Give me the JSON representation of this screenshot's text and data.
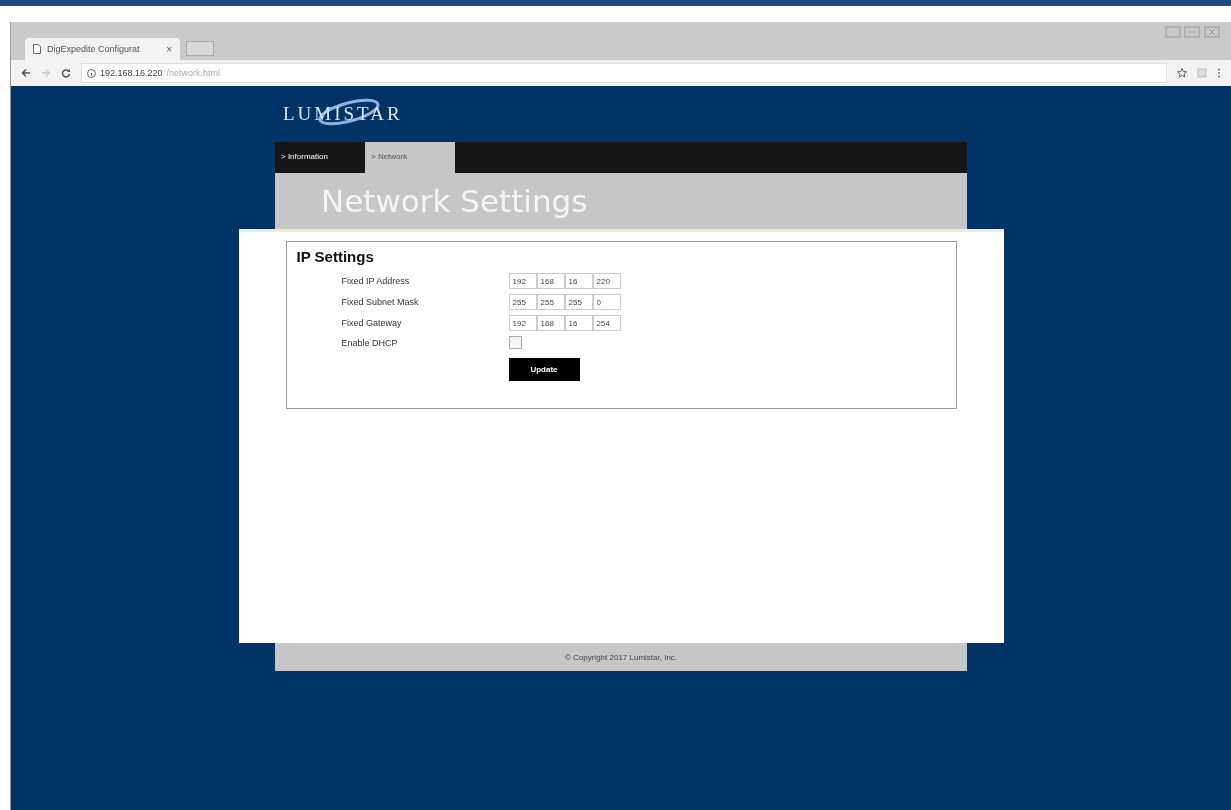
{
  "browser": {
    "tab_title": "DigExpedite Configurat",
    "tab_close": "×",
    "address_host": "192.168.16.220",
    "address_path": "/network.html"
  },
  "logo": {
    "text": "LUMISTAR"
  },
  "nav": [
    {
      "label": "> Information",
      "selected": false
    },
    {
      "label": "> Network",
      "selected": true
    }
  ],
  "page_title": "Network Settings",
  "section": {
    "title": "IP Settings",
    "rows": [
      {
        "kind": "ip",
        "label": "Fixed IP Address",
        "octets": [
          "192",
          "168",
          "16",
          "220"
        ]
      },
      {
        "kind": "ip",
        "label": "Fixed Subnet Mask",
        "octets": [
          "255",
          "255",
          "255",
          "0"
        ]
      },
      {
        "kind": "ip",
        "label": "Fixed Gateway",
        "octets": [
          "192",
          "168",
          "16",
          "254"
        ]
      },
      {
        "kind": "checkbox",
        "label": "Enable DHCP",
        "checked": false
      }
    ],
    "button": "Update"
  },
  "footer": "© Copyright 2017 Lumistar, Inc."
}
